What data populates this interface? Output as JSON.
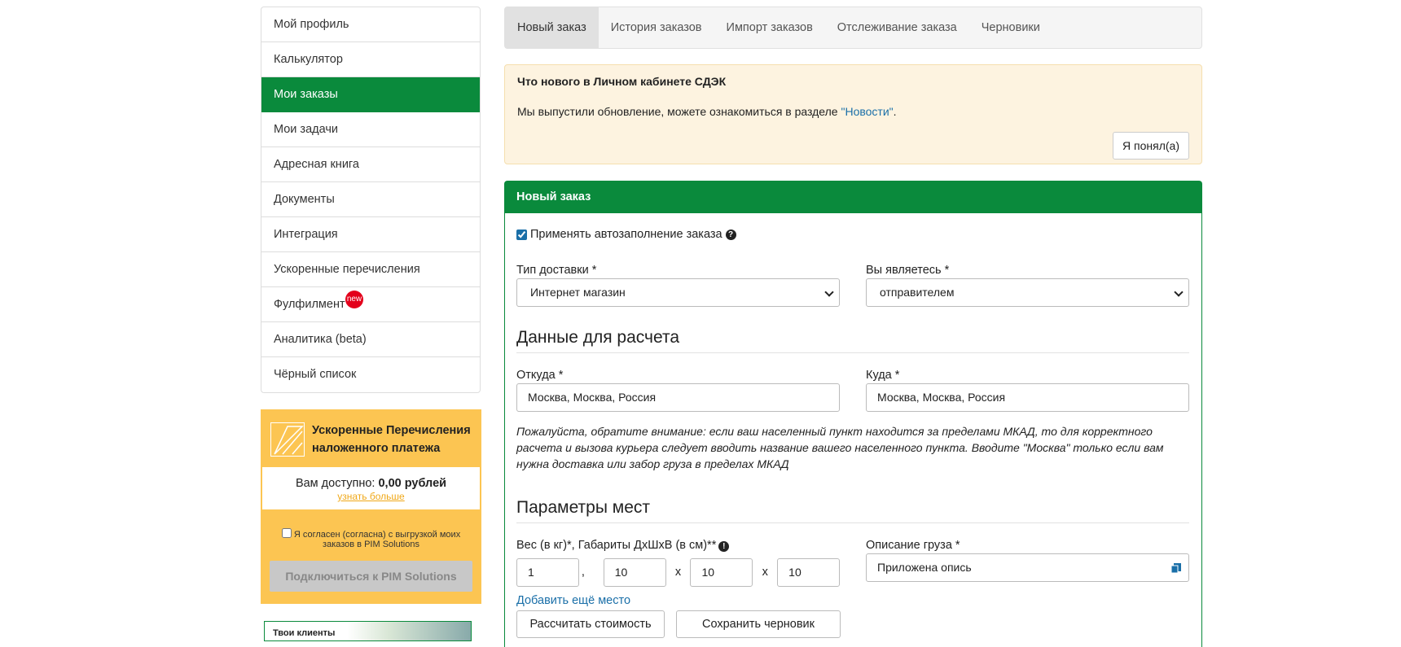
{
  "sidebar": {
    "items": [
      {
        "label": "Мой профиль"
      },
      {
        "label": "Калькулятор"
      },
      {
        "label": "Мои заказы"
      },
      {
        "label": "Мои задачи"
      },
      {
        "label": "Адресная книга"
      },
      {
        "label": "Документы"
      },
      {
        "label": "Интеграция"
      },
      {
        "label": "Ускоренные перечисления"
      },
      {
        "label": "Фулфилмент",
        "badge": "new"
      },
      {
        "label": "Аналитика (beta)"
      },
      {
        "label": "Чёрный список"
      }
    ],
    "active_index": 2
  },
  "promo": {
    "title": "Ускоренные Перечисления наложенного платежа",
    "available_label": "Вам доступно: ",
    "available_value": "0,00 рублей",
    "more_link": "узнать больше",
    "agree_text": "Я согласен (согласна) с выгрузкой моих заказов в PIM Solutions",
    "connect_button": "Подключиться к PIM Solutions"
  },
  "banner": {
    "text": "Твои клиенты"
  },
  "tabs": [
    {
      "label": "Новый заказ",
      "active": true
    },
    {
      "label": "История заказов"
    },
    {
      "label": "Импорт заказов"
    },
    {
      "label": "Отслеживание заказа"
    },
    {
      "label": "Черновики"
    }
  ],
  "notice": {
    "title": "Что нового в Личном кабинете СДЭК",
    "text_before": "Мы выпустили обновление, можете ознакомиться в разделе ",
    "link": "\"Новости\"",
    "text_after": ".",
    "button": "Я понял(а)"
  },
  "order": {
    "header": "Новый заказ",
    "autofill_label": "Применять автозаполнение заказа",
    "autofill_checked": true,
    "delivery_type_label": "Тип доставки *",
    "delivery_type_value": "Интернет магазин",
    "role_label": "Вы являетесь *",
    "role_value": "отправителем",
    "calc_section": "Данные для расчета",
    "from_label": "Откуда *",
    "from_value": "Москва, Москва, Россия",
    "to_label": "Куда *",
    "to_value": "Москва, Москва, Россия",
    "note": "Пожалуйста, обратите внимание: если ваш населенный пункт находится за пределами МКАД, то для корректного расчета и вызова курьера следует вводить название вашего населенного пункта. Вводите \"Москва\" только если вам нужна доставка или забор груза в пределах МКАД",
    "places_section": "Параметры мест",
    "weight_label": "Вес (в кг)*, Габариты ДхШхВ (в см)**",
    "weight": "1",
    "length": "10",
    "width": "10",
    "height": "10",
    "comma": ",",
    "x1": "x",
    "x2": "x",
    "cargo_label": "Описание груза *",
    "cargo_value": "Приложена опись",
    "add_place": "Добавить ещё место",
    "calc_button": "Рассчитать стоимость",
    "draft_button": "Сохранить черновик"
  },
  "colors": {
    "brand_green": "#0a8a3c",
    "promo_yellow": "#fcc552",
    "badge_red": "#e3001b",
    "link_blue": "#1a6fa8"
  }
}
